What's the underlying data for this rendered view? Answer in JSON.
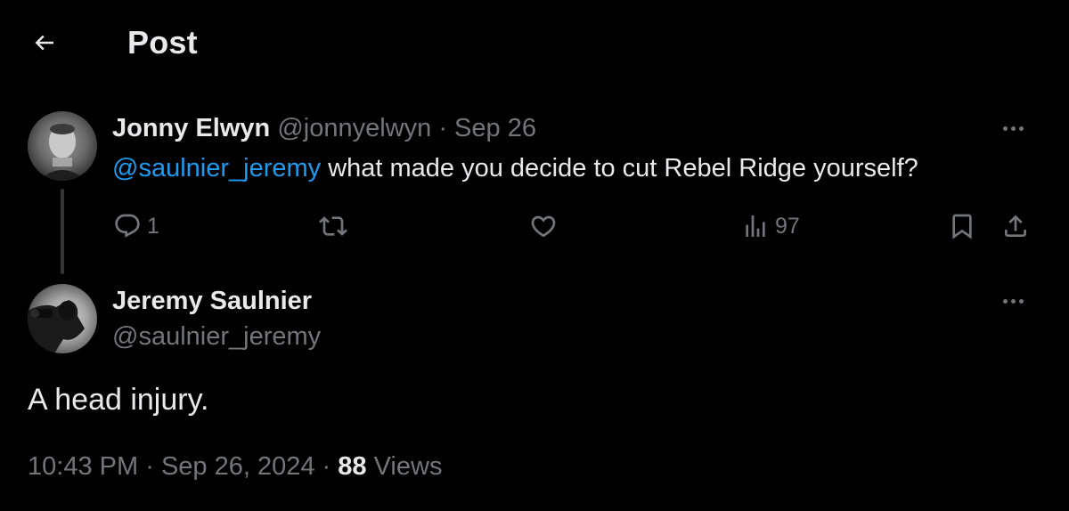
{
  "header": {
    "title": "Post",
    "back_icon": "arrow-left-icon"
  },
  "parent_tweet": {
    "author_name": "Jonny Elwyn",
    "author_handle": "@jonnyelwyn",
    "separator": "·",
    "date": "Sep 26",
    "mention": "@saulnier_jeremy",
    "text": " what made you decide to cut Rebel Ridge yourself?",
    "actions": {
      "reply_count": "1",
      "repost_count": "",
      "like_count": "",
      "views_count": "97"
    }
  },
  "main_tweet": {
    "author_name": "Jeremy Saulnier",
    "author_handle": "@saulnier_jeremy",
    "text": "A head injury.",
    "time": "10:43 PM",
    "separator": "·",
    "date": "Sep 26, 2024",
    "views_count": "88",
    "views_label": "Views"
  },
  "colors": {
    "background": "#000000",
    "text": "#e7e9ea",
    "muted": "#71767b",
    "link": "#1d9bf0"
  }
}
